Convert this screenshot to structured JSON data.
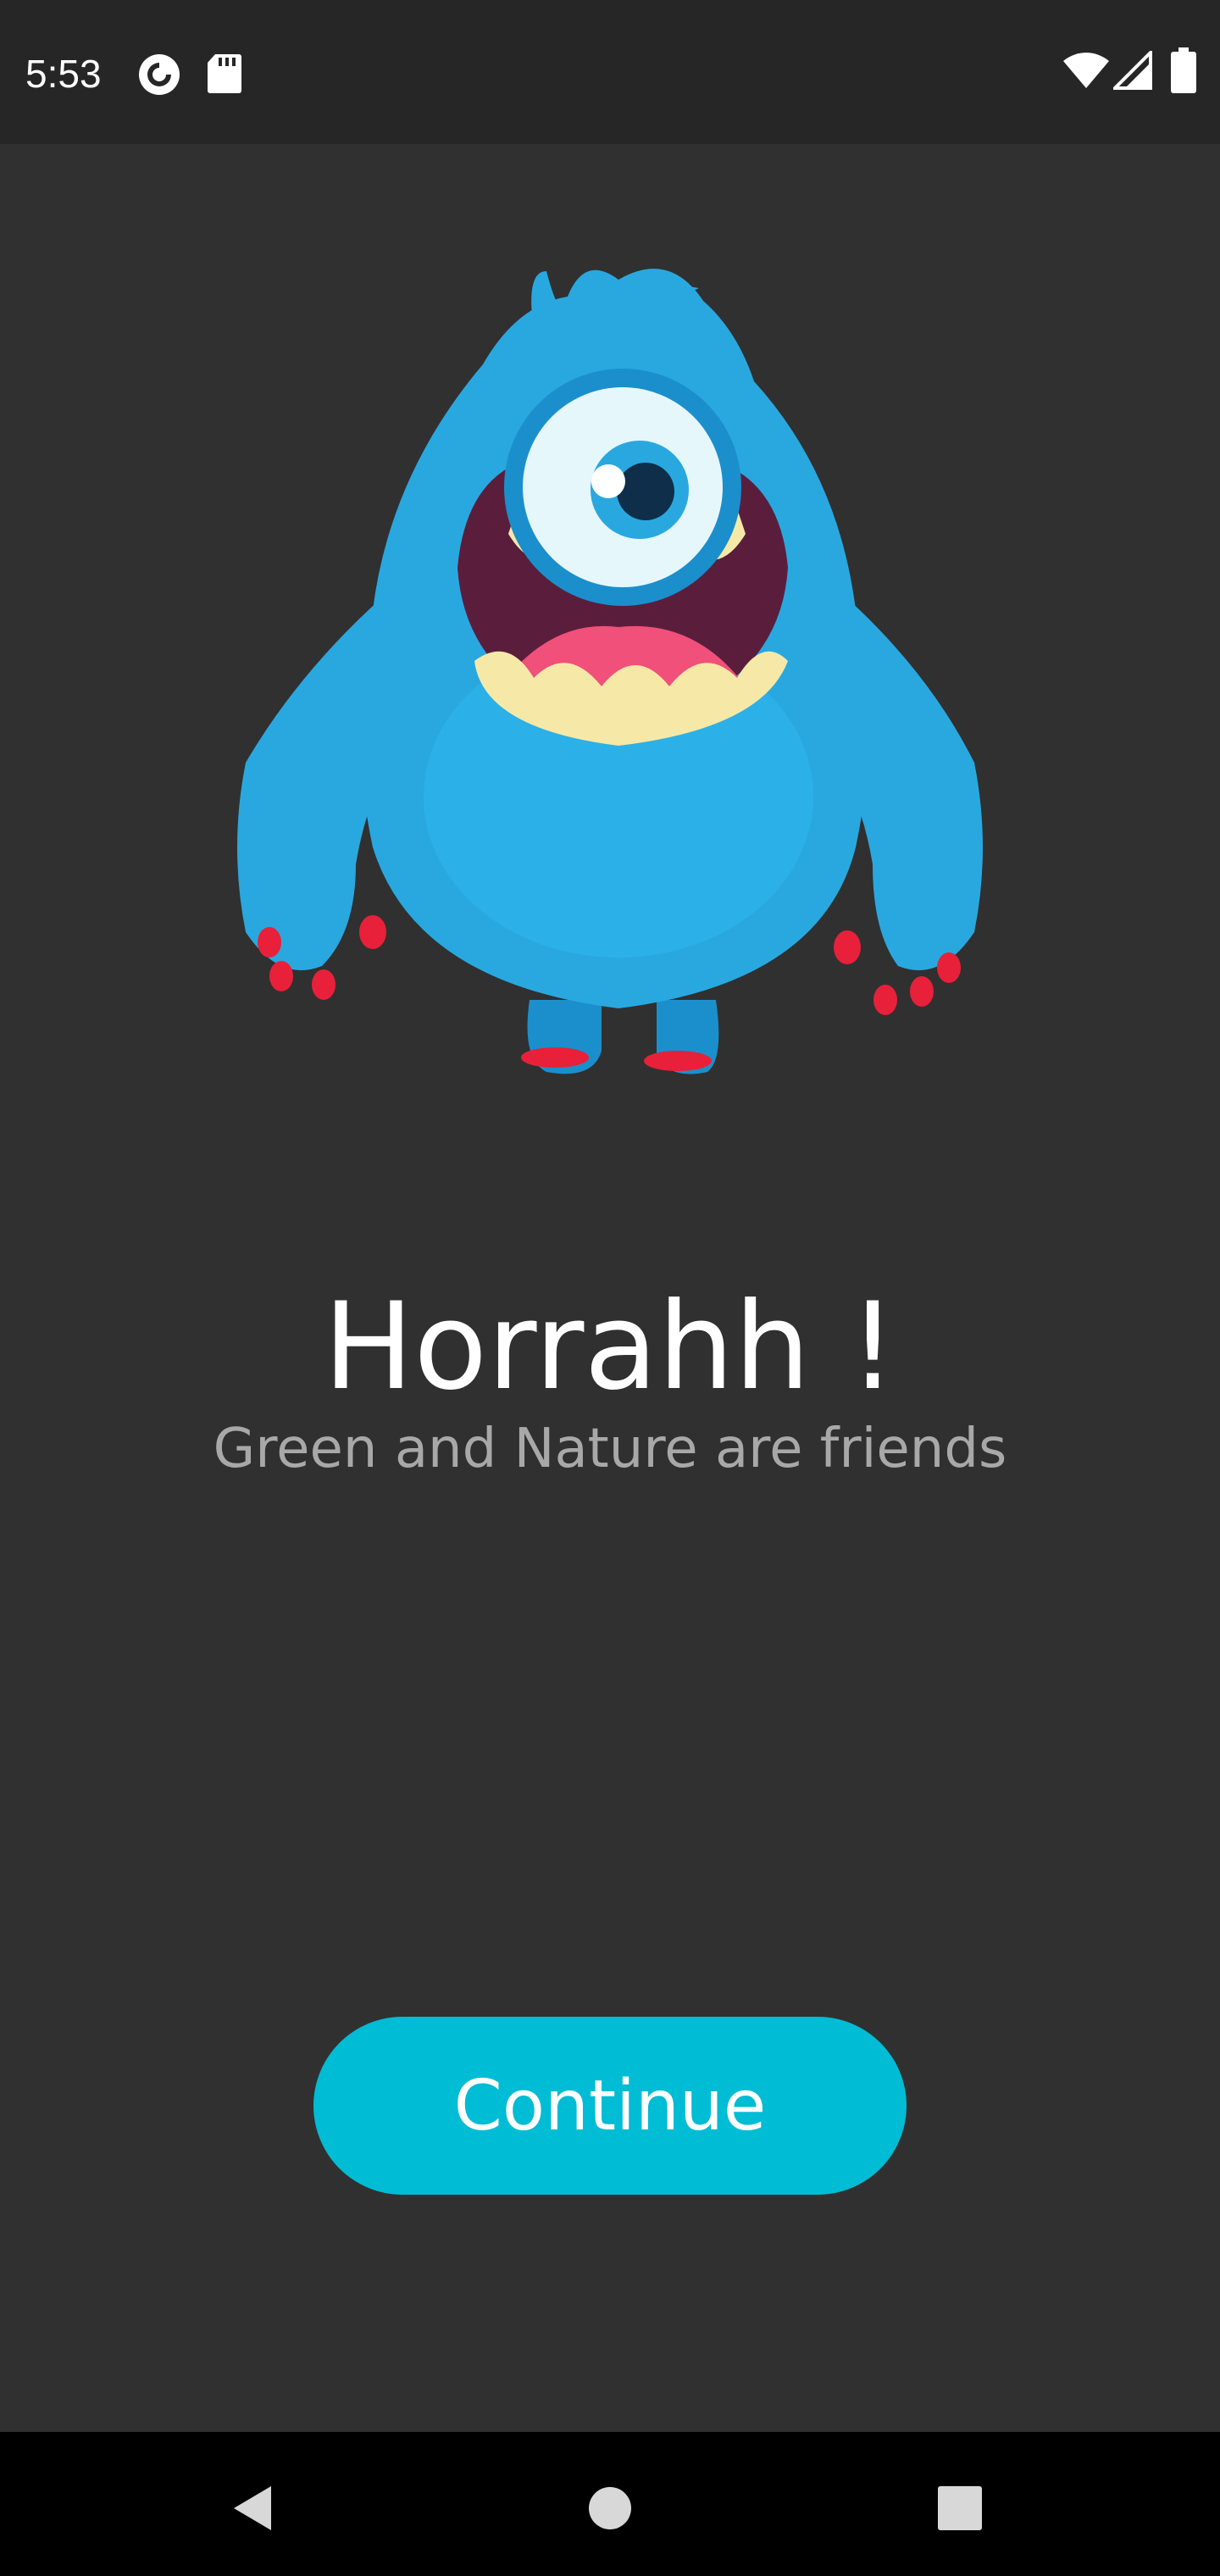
{
  "status_bar": {
    "time": "5:53",
    "left_icons": [
      "pocket-casts-icon",
      "sd-card-icon"
    ],
    "right_icons": [
      "wifi-icon",
      "cellular-signal-icon",
      "battery-icon"
    ]
  },
  "illustration": {
    "subject": "blue-one-eyed-monster",
    "colors": {
      "fur": "#29a8e0",
      "fur_dark": "#1b8fcc",
      "mouth": "#5a1e3c",
      "teeth": "#f6e9a8",
      "tongue": "#f0507a",
      "claws": "#e8203a"
    }
  },
  "main": {
    "title": "Horrahh !",
    "subtitle": "Green and Nature are friends",
    "continue_label": "Continue"
  },
  "nav_bar": {
    "buttons": [
      "back-icon",
      "home-icon",
      "recents-icon"
    ]
  },
  "colors": {
    "background": "#303030",
    "status_bar": "#262626",
    "accent": "#00bcd4",
    "title_text": "#ffffff",
    "subtitle_text": "#a8a8a8"
  }
}
